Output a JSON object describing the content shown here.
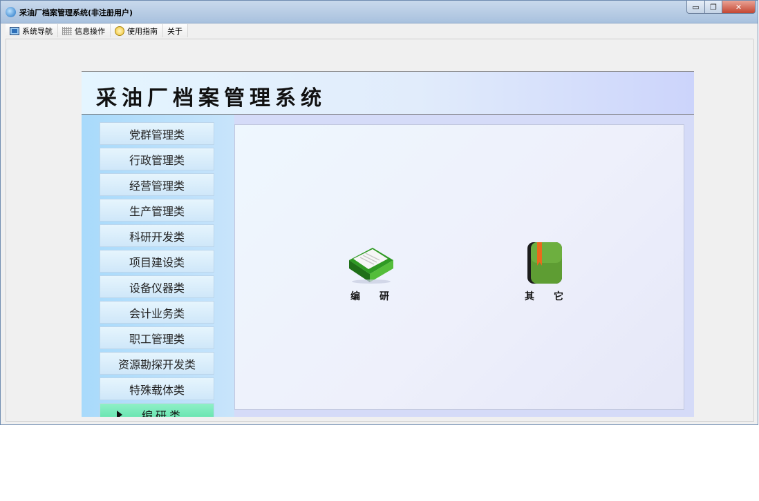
{
  "window": {
    "title": "采油厂档案管理系统(非注册用户)",
    "controls": {
      "minimize": "▭",
      "maximize": "❐",
      "close": "✕"
    }
  },
  "menu": [
    {
      "label": "系统导航",
      "icon": "monitor-icon"
    },
    {
      "label": "信息操作",
      "icon": "grid-icon"
    },
    {
      "label": "使用指南",
      "icon": "lightbulb-icon"
    },
    {
      "label": "关于"
    }
  ],
  "header": {
    "title": "采油厂档案管理系统"
  },
  "sidebar": {
    "items": [
      {
        "label": "党群管理类"
      },
      {
        "label": "行政管理类"
      },
      {
        "label": "经营管理类"
      },
      {
        "label": "生产管理类"
      },
      {
        "label": "科研开发类"
      },
      {
        "label": "项目建设类"
      },
      {
        "label": "设备仪器类"
      },
      {
        "label": "会计业务类"
      },
      {
        "label": "职工管理类"
      },
      {
        "label": "资源勘探开发类"
      },
      {
        "label": "特殊载体类"
      },
      {
        "label": "编研类",
        "active": true
      }
    ]
  },
  "content": {
    "tiles": [
      {
        "label": "编　　研",
        "icon": "green-book-icon"
      },
      {
        "label": "其　　它",
        "icon": "green-notebook-icon"
      }
    ]
  },
  "colors": {
    "sidebar_bg": "#a8dafb",
    "active_item": "#55dfa5",
    "header_bg": "#e4f5ff"
  }
}
